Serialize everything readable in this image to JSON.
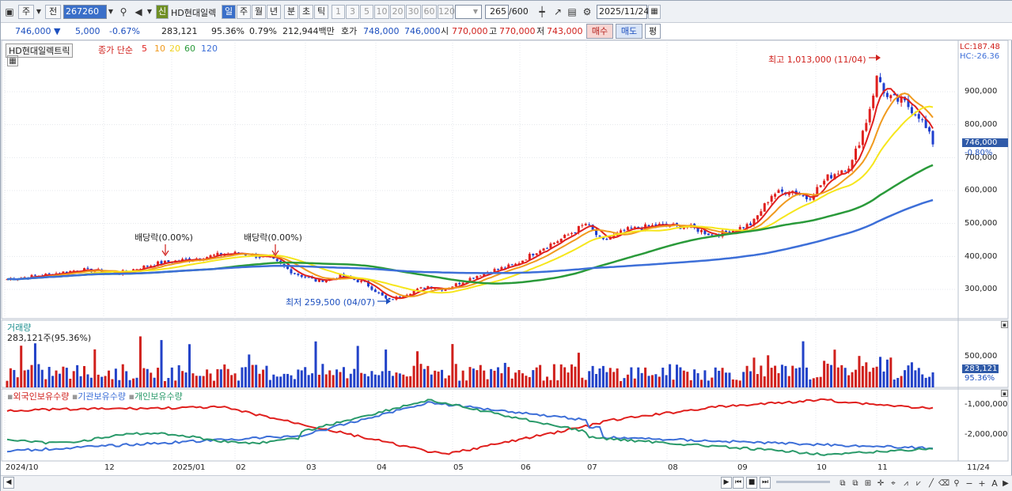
{
  "toolbar": {
    "tab_ju": "주",
    "tab_jeon": "전",
    "code": "267260",
    "badge": "신",
    "name": "HD현대일렉",
    "periods": [
      "일",
      "주",
      "월",
      "년",
      "분",
      "초",
      "틱"
    ],
    "counts": [
      "1",
      "3",
      "5",
      "10",
      "20",
      "30",
      "60",
      "120"
    ],
    "range": "265",
    "range_total": "/600",
    "date": "2025/11/24"
  },
  "quote": {
    "price": "746,000",
    "change": "5,000",
    "change_pct": "-0.67%",
    "volume": "283,121",
    "vol_ratio": "95.36%",
    "turnover_ratio": "0.79%",
    "amount": "212,944백만",
    "ask_label": "호가",
    "ask": "748,000",
    "bid": "746,000",
    "open_label": "시",
    "open": "770,000",
    "high_label": "고",
    "high": "770,000",
    "low_label": "저",
    "low": "743,000",
    "buy_button": "매수",
    "sell_button": "매도",
    "eval_button": "평"
  },
  "price_panel": {
    "title": "HD현대일렉트릭",
    "ma_label": "종가 단순",
    "ma_periods": [
      "5",
      "10",
      "20",
      "60",
      "120"
    ],
    "ma_colors": [
      "#e0201e",
      "#f09a1e",
      "#f6e61c",
      "#2a9a3a",
      "#3d6fd8"
    ],
    "lc": "LC:187.48",
    "hc": "HC:-26.36",
    "last_price": "746,000",
    "last_pct": "-0.80%",
    "high_note": "최고 1,013,000 (11/04)",
    "low_note": "최저 259,500 (04/07)",
    "div_note1": "배당락(0.00%)",
    "div_note2": "배당락(0.00%)",
    "y_ticks": [
      "900,000",
      "800,000",
      "700,000",
      "600,000",
      "500,000",
      "400,000",
      "300,000"
    ]
  },
  "volume_panel": {
    "title": "거래량",
    "info": "283,121주(95.36%)",
    "y_tick": "500,000",
    "last": "283,121",
    "last_pct": "95.36%"
  },
  "holding_panel": {
    "series": [
      "외국인보유수량",
      "기관보유수량",
      "개인보유수량"
    ],
    "colors": [
      "#e0201e",
      "#3d6fd8",
      "#2a9a6a"
    ],
    "y_ticks": [
      "-1,000,000",
      "-2,000,000"
    ]
  },
  "x_axis": {
    "labels": [
      "2024/10",
      "12",
      "2025/01",
      "02",
      "03",
      "04",
      "05",
      "06",
      "07",
      "08",
      "09",
      "10",
      "11"
    ],
    "right_label": "11/24"
  },
  "chart_data": {
    "type": "candlestick",
    "title": "HD현대일렉트릭",
    "x_range": [
      "2024/10",
      "2025/11/24"
    ],
    "ylim": [
      250000,
      1050000
    ],
    "price_close_approx": [
      {
        "x": "2024/10",
        "y": 330000
      },
      {
        "x": "12",
        "y": 360000
      },
      {
        "x": "2025/01",
        "y": 390000
      },
      {
        "x": "02",
        "y": 410000
      },
      {
        "x": "03",
        "y": 330000
      },
      {
        "x": "04",
        "y": 300000
      },
      {
        "x": "05",
        "y": 320000
      },
      {
        "x": "06",
        "y": 380000
      },
      {
        "x": "07",
        "y": 490000
      },
      {
        "x": "08",
        "y": 480000
      },
      {
        "x": "09",
        "y": 500000
      },
      {
        "x": "10",
        "y": 600000
      },
      {
        "x": "11",
        "y": 900000
      },
      {
        "x": "11/24",
        "y": 746000
      }
    ],
    "high": {
      "value": 1013000,
      "date": "11/04"
    },
    "low": {
      "value": 259500,
      "date": "04/07"
    },
    "last_volume": 283121,
    "volume_tick": 500000
  }
}
